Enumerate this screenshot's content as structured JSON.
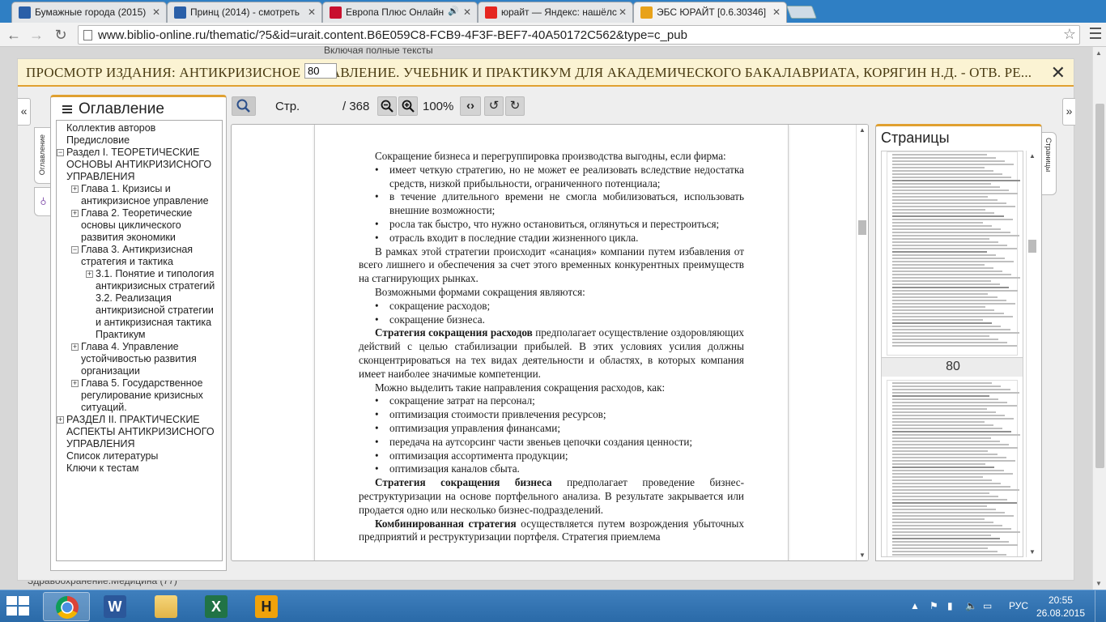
{
  "browser": {
    "tabs": [
      {
        "title": "Бумажные города (2015)",
        "favicon_color": "#2a5fa8",
        "sound": false
      },
      {
        "title": "Принц (2014) - смотреть",
        "favicon_color": "#2a5fa8",
        "sound": false
      },
      {
        "title": "Европа Плюс Онлайн",
        "favicon_color": "#c8102e",
        "sound": true
      },
      {
        "title": "юрайт — Яндекс: нашёлс",
        "favicon_color": "#e52620",
        "sound": false
      },
      {
        "title": "ЭБС ЮРАЙТ [0.6.30346]",
        "favicon_color": "#e8a21a",
        "sound": false,
        "active": true
      }
    ],
    "url": "www.biblio-online.ru/thematic/?5&id=urait.content.B6E059C8-FCB9-4F3F-BEF7-40A50172C562&type=c_pub",
    "back_icon": "arrow-left-icon",
    "forward_icon": "arrow-right-icon",
    "reload_icon": "reload-icon"
  },
  "page": {
    "behind_text_top": "Включая полные тексты",
    "behind_text_bottom": "Здравоохранение.Медицина (77)"
  },
  "modal": {
    "title": "ПРОСМОТР ИЗДАНИЯ: АНТИКРИЗИСНОЕ УПРАВЛЕНИЕ. УЧЕБНИК И ПРАКТИКУМ ДЛЯ АКАДЕМИЧЕСКОГО БАКАЛАВРИАТА, КОРЯГИН Н.Д. - ОТВ. РЕ...",
    "close_label": "✕",
    "collapse_left": "«",
    "expand_right": "»"
  },
  "toc": {
    "heading": "Оглавление",
    "tab_label": "Оглавление",
    "search_tab_icon": "search-icon",
    "items": [
      {
        "label": "Коллектив авторов",
        "level": 0,
        "expander": ""
      },
      {
        "label": "Предисловие",
        "level": 0,
        "expander": ""
      },
      {
        "label": "Раздел I. ТЕОРЕТИЧЕСКИЕ ОСНОВЫ АНТИКРИЗИСНОГО УПРАВЛЕНИЯ",
        "level": 0,
        "expander": "−"
      },
      {
        "label": "Глава 1. Кризисы и антикризисное управление",
        "level": 1,
        "expander": "+"
      },
      {
        "label": "Глава 2. Теоретические основы циклического развития экономики",
        "level": 1,
        "expander": "+"
      },
      {
        "label": "Глава 3. Антикризисная стратегия и тактика",
        "level": 1,
        "expander": "−"
      },
      {
        "label": "3.1. Понятие и типология антикризисных стратегий",
        "level": 2,
        "expander": "+"
      },
      {
        "label": "3.2. Реализация антикризисной стратегии и антикризисная тактика",
        "level": 2,
        "expander": ""
      },
      {
        "label": "Практикум",
        "level": 2,
        "expander": ""
      },
      {
        "label": "Глава 4. Управление устойчивостью развития организации",
        "level": 1,
        "expander": "+"
      },
      {
        "label": "Глава 5. Государственное регулирование кризисных ситуаций.",
        "level": 1,
        "expander": "+"
      },
      {
        "label": "РАЗДЕЛ II. ПРАКТИЧЕСКИЕ АСПЕКТЫ АНТИКРИЗИСНОГО УПРАВЛЕНИЯ",
        "level": -1,
        "expander": "+"
      },
      {
        "label": "Список литературы",
        "level": 0,
        "expander": ""
      },
      {
        "label": "Ключи к тестам",
        "level": 0,
        "expander": ""
      }
    ]
  },
  "viewer": {
    "page_label": "Стр.",
    "page_value": "80",
    "page_total": "/ 368",
    "zoom": "100%",
    "icons": {
      "search": "search-icon",
      "zoom_out": "zoom-out-icon",
      "zoom_in": "zoom-in-icon",
      "fit_width": "fit-width-icon",
      "rotate_left": "rotate-left-icon",
      "rotate_right": "rotate-right-icon"
    }
  },
  "document": {
    "p1": "Сокращение бизнеса и перегруппировка производства выгодны, если фирма:",
    "b1": "имеет четкую стратегию, но не может ее реализовать вследствие недостатка средств, низкой прибыльности, ограниченного потенциала;",
    "b2": "в течение длительного времени не смогла мобилизоваться, использовать внешние возможности;",
    "b3": "росла так быстро, что нужно остановиться, оглянуться и перестроиться;",
    "b4": "отрасль входит в последние стадии жизненного цикла.",
    "p2": "В рамках этой стратегии происходит «санация» компании путем избавления от всего лишнего и обеспечения за счет этого временных конкурентных преимуществ на стагнирующих рынках.",
    "p3": "Возможными формами сокращения являются:",
    "b5": "сокращение расходов;",
    "b6": "сокращение бизнеса.",
    "p4_bold": "Стратегия сокращения расходов",
    "p4_rest": " предполагает осуществление оздоровляющих действий с целью стабилизации прибылей. В этих условиях усилия должны сконцентрироваться на тех видах деятельности и областях, в которых компания имеет наиболее значимые компетенции.",
    "p5": "Можно выделить такие направления сокращения расходов, как:",
    "b7": "сокращение затрат на персонал;",
    "b8": "оптимизация стоимости привлечения ресурсов;",
    "b9": "оптимизация управления финансами;",
    "b10": "передача на аутсорсинг части звеньев цепочки создания ценности;",
    "b11": "оптимизация ассортимента продукции;",
    "b12": "оптимизация каналов сбыта.",
    "p6_bold": "Стратегия сокращения бизнеса",
    "p6_rest": " предполагает проведение бизнес-реструктуризации на основе портфельного анализа. В результате закрывается или продается одно или несколько бизнес-подразделений.",
    "p7_bold": "Комбинированная стратегия",
    "p7_rest": " осуществляется путем возрождения убыточных предприятий и реструктуризации портфеля. Стратегия приемлема"
  },
  "pages_panel": {
    "heading": "Страницы",
    "tab_label": "Страницы",
    "current_page_label": "80"
  },
  "taskbar": {
    "apps": [
      {
        "name": "chrome",
        "icon": "chrome-icon",
        "active": true
      },
      {
        "name": "word",
        "icon": "word-icon",
        "letter": "W"
      },
      {
        "name": "explorer",
        "icon": "folder-icon"
      },
      {
        "name": "excel",
        "icon": "excel-icon",
        "letter": "X"
      },
      {
        "name": "h-app",
        "icon": "h-app-icon",
        "letter": "H"
      }
    ],
    "language": "РУС",
    "time": "20:55",
    "date": "26.08.2015"
  }
}
